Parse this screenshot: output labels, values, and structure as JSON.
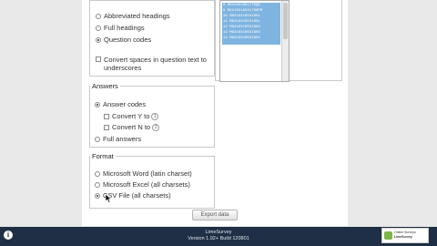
{
  "headings": {
    "options": [
      {
        "label": "Abbreviated headings",
        "selected": false
      },
      {
        "label": "Full headings",
        "selected": false
      },
      {
        "label": "Question codes",
        "selected": true
      }
    ],
    "convert_spaces_label": "Convert spaces in question text to underscores"
  },
  "columns_list": {
    "items": [
      "8 M8216X1851776Q6",
      "9 M8216X185X1786PM",
      "10 M8216X185X1801",
      "11 M8216X185X1801",
      "12 M8216X185X1802",
      "13 M8216X185X1803",
      "14 M8216X185X1804"
    ]
  },
  "answers": {
    "legend": "Answers",
    "answer_codes_label": "Answer codes",
    "convert_y_label": "Convert Y to",
    "convert_y_value": "1",
    "convert_n_label": "Convert N to",
    "convert_n_value": "2",
    "full_answers_label": "Full answers"
  },
  "format": {
    "legend": "Format",
    "options": [
      {
        "label": "Microsoft Word (latin charset)",
        "selected": false
      },
      {
        "label": "Microsoft Excel (all charsets)",
        "selected": false
      },
      {
        "label": "CSV File (all charsets)",
        "selected": true
      }
    ]
  },
  "export_button": "Export data",
  "footer": {
    "brand": "LimeSurvey",
    "version": "Version 1.92+ Build 120801",
    "badge_line1": "Online Surveys",
    "badge_line2": "LimeSurvey",
    "info_icon": "i"
  },
  "icons": {
    "info": "info-icon",
    "cursor": "cursor-icon"
  }
}
